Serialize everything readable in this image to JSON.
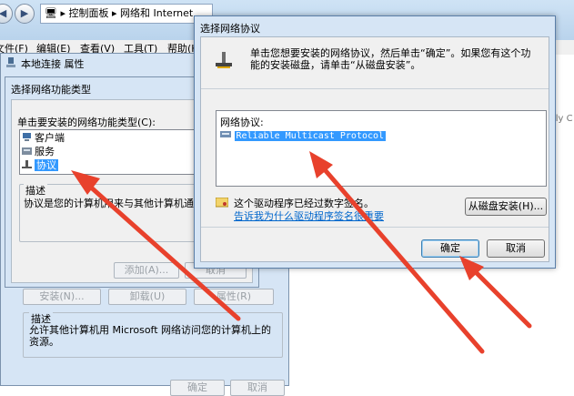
{
  "explorer": {
    "breadcrumb": [
      "控制面板",
      "网络和 Internet"
    ],
    "menu": [
      "文件(F)",
      "编辑(E)",
      "查看(V)",
      "工具(T)",
      "帮助(H)"
    ],
    "right_text": "ily C"
  },
  "lan_properties": {
    "title": "本地连接 属性",
    "install_button": "安装(N)...",
    "uninstall_button": "卸载(U)",
    "properties_button": "属性(R)",
    "description_heading": "描述",
    "description_text": "允许其他计算机用 Microsoft 网络访问您的计算机上的资源。",
    "ok_button": "确定",
    "cancel_button": "取消"
  },
  "feature_type_dialog": {
    "title": "选择网络功能类型",
    "prompt": "单击要安装的网络功能类型(C):",
    "items": [
      "客户端",
      "服务",
      "协议"
    ],
    "selected_index": 2,
    "description_heading": "描述",
    "description_text": "协议是您的计算机用来与其他计算机通信的语言。",
    "add_button": "添加(A)...",
    "cancel_button": "取消"
  },
  "protocol_dialog": {
    "title": "选择网络协议",
    "instruction": "单击您想要安装的网络协议，然后单击“确定”。如果您有这个功能的安装磁盘，请单击“从磁盘安装”。",
    "list_heading": "网络协议:",
    "protocols": [
      "Reliable Multicast Protocol"
    ],
    "signed_text": "这个驱动程序已经过数字签名。",
    "signing_link": "告诉我为什么驱动程序签名很重要",
    "have_disk_button": "从磁盘安装(H)...",
    "ok_button": "确定",
    "cancel_button": "取消"
  },
  "colors": {
    "annotation_arrow": "#e8412c",
    "selection": "#3399ff",
    "window_frame": "#d6e5f5"
  }
}
